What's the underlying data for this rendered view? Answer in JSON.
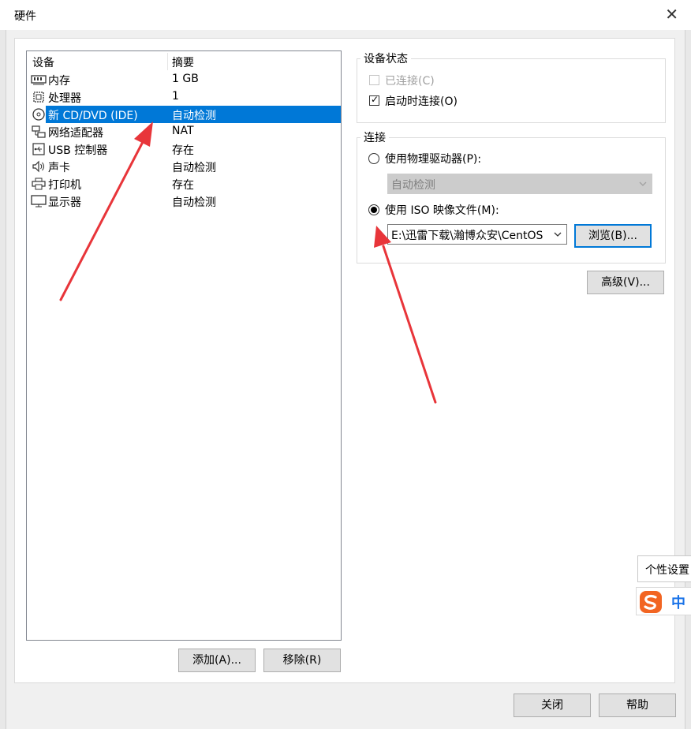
{
  "window": {
    "title": "硬件",
    "close_glyph": "✕"
  },
  "device_list": {
    "columns": {
      "device": "设备",
      "summary": "摘要"
    },
    "items": [
      {
        "icon": "memory-icon",
        "label": "内存",
        "summary": "1 GB"
      },
      {
        "icon": "processor-icon",
        "label": "处理器",
        "summary": "1"
      },
      {
        "icon": "cd-dvd-icon",
        "label": "新 CD/DVD (IDE)",
        "summary": "自动检测",
        "selected": true
      },
      {
        "icon": "network-adapter-icon",
        "label": "网络适配器",
        "summary": "NAT"
      },
      {
        "icon": "usb-icon",
        "label": "USB 控制器",
        "summary": "存在"
      },
      {
        "icon": "speaker-icon",
        "label": "声卡",
        "summary": "自动检测"
      },
      {
        "icon": "printer-icon",
        "label": "打印机",
        "summary": "存在"
      },
      {
        "icon": "monitor-icon",
        "label": "显示器",
        "summary": "自动检测"
      }
    ],
    "add_button": "添加(A)...",
    "remove_button": "移除(R)"
  },
  "device_status": {
    "legend": "设备状态",
    "connected": {
      "label": "已连接(C)",
      "checked": false,
      "disabled": true
    },
    "connect_at_power_on": {
      "label": "启动时连接(O)",
      "checked": true
    }
  },
  "connection": {
    "legend": "连接",
    "physical_drive": {
      "label": "使用物理驱动器(P):",
      "selected": false
    },
    "physical_drive_select": "自动检测",
    "iso_image": {
      "label": "使用 ISO 映像文件(M):",
      "selected": true
    },
    "iso_path": "E:\\迅雷下载\\瀚博众安\\CentOS",
    "browse_button": "浏览(B)..."
  },
  "advanced_button": "高级(V)...",
  "footer": {
    "close_button": "关闭",
    "help_button": "帮助"
  },
  "ime": {
    "tooltip": "个性设置",
    "mode": "中"
  },
  "colors": {
    "selection": "#0078d7",
    "annotation_arrow": "#e8353a",
    "ime_logo": "#f26522"
  }
}
